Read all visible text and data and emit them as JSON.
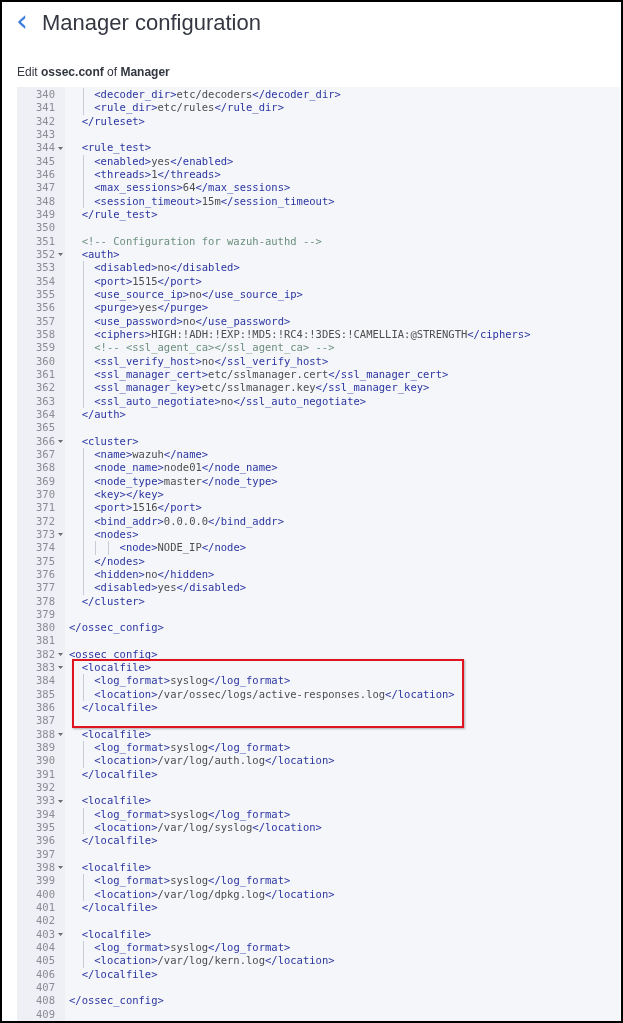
{
  "header": {
    "back": "‹",
    "title": "Manager configuration",
    "subtitle": "Edit **ossec.conf** of **Manager**"
  },
  "editor": {
    "lines": [
      {
        "number": "340",
        "text": "    <decoder_dir>etc/decoders</decoder_dir>",
        "foldable": false,
        "highlighted": false
      },
      {
        "number": "341",
        "text": "    <rule_dir>etc/rules</rule_dir>",
        "foldable": false,
        "highlighted": false
      },
      {
        "number": "342",
        "text": "  </ruleset>",
        "foldable": false,
        "highlighted": false
      },
      {
        "number": "343",
        "foldable": false,
        "highlighted": false
      },
      {
        "number": "344",
        "text": "  <rule_test>",
        "foldable": true,
        "highlighted": false
      },
      {
        "number": "345",
        "text": "    <enabled>yes</enabled>",
        "foldable": false,
        "highlighted": false
      },
      {
        "number": "346",
        "text": "    <threads>1</threads>",
        "foldable": false,
        "highlighted": false
      },
      {
        "number": "347",
        "text": "    <max_sessions>64</max_sessions>",
        "foldable": false,
        "highlighted": false
      },
      {
        "number": "348",
        "text": "    <session_timeout>15m</session_timeout>",
        "foldable": false,
        "highlighted": false
      },
      {
        "number": "349",
        "text": "  </rule_test>",
        "foldable": false,
        "highlighted": false
      },
      {
        "number": "350",
        "foldable": false,
        "highlighted": false
      },
      {
        "number": "351",
        "text": "  <!-- Configuration for wazuh-authd -->",
        "foldable": false,
        "highlighted": false
      },
      {
        "number": "352",
        "text": "  <auth>",
        "foldable": true,
        "highlighted": false
      },
      {
        "number": "353",
        "text": "    <disabled>no</disabled>",
        "foldable": false,
        "highlighted": false
      },
      {
        "number": "354",
        "text": "    <port>1515</port>",
        "foldable": false,
        "highlighted": false
      },
      {
        "number": "355",
        "text": "    <use_source_ip>no</use_source_ip>",
        "foldable": false,
        "highlighted": false
      },
      {
        "number": "356",
        "text": "    <purge>yes</purge>",
        "foldable": false,
        "highlighted": false
      },
      {
        "number": "357",
        "text": "    <use_password>no</use_password>",
        "foldable": false,
        "highlighted": false
      },
      {
        "number": "358",
        "text": "    <ciphers>HIGH:!ADH:!EXP:!MD5:!RC4:!3DES:!CAMELLIA:@STRENGTH</ciphers>",
        "foldable": false,
        "highlighted": false
      },
      {
        "number": "359",
        "text": "    <!-- <ssl_agent_ca></ssl_agent_ca> -->",
        "foldable": false,
        "highlighted": false
      },
      {
        "number": "360",
        "text": "    <ssl_verify_host>no</ssl_verify_host>",
        "foldable": false,
        "highlighted": false
      },
      {
        "number": "361",
        "text": "    <ssl_manager_cert>etc/sslmanager.cert</ssl_manager_cert>",
        "foldable": false,
        "highlighted": false
      },
      {
        "number": "362",
        "text": "    <ssl_manager_key>etc/sslmanager.key</ssl_manager_key>",
        "foldable": false,
        "highlighted": false
      },
      {
        "number": "363",
        "text": "    <ssl_auto_negotiate>no</ssl_auto_negotiate>",
        "foldable": false,
        "highlighted": false
      },
      {
        "number": "364",
        "text": "  </auth>",
        "foldable": false,
        "highlighted": false
      },
      {
        "number": "365",
        "foldable": false,
        "highlighted": false
      },
      {
        "number": "366",
        "text": "  <cluster>",
        "foldable": true,
        "highlighted": false
      },
      {
        "number": "367",
        "text": "    <name>wazuh</name>",
        "foldable": false,
        "highlighted": false
      },
      {
        "number": "368",
        "text": "    <node_name>node01</node_name>",
        "foldable": false,
        "highlighted": false
      },
      {
        "number": "369",
        "text": "    <node_type>master</node_type>",
        "foldable": false,
        "highlighted": false
      },
      {
        "number": "370",
        "text": "    <key></key>",
        "foldable": false,
        "highlighted": false
      },
      {
        "number": "371",
        "text": "    <port>1516</port>",
        "foldable": false,
        "highlighted": false
      },
      {
        "number": "372",
        "text": "    <bind_addr>0.0.0.0</bind_addr>",
        "foldable": false,
        "highlighted": false
      },
      {
        "number": "373",
        "text": "    <nodes>",
        "foldable": true,
        "highlighted": false
      },
      {
        "number": "374",
        "text": "        <node>NODE_IP</node>",
        "foldable": false,
        "highlighted": false
      },
      {
        "number": "375",
        "text": "    </nodes>",
        "foldable": false,
        "highlighted": false
      },
      {
        "number": "376",
        "text": "    <hidden>no</hidden>",
        "foldable": false,
        "highlighted": false
      },
      {
        "number": "377",
        "text": "    <disabled>yes</disabled>",
        "foldable": false,
        "highlighted": false
      },
      {
        "number": "378",
        "text": "  </cluster>",
        "foldable": false,
        "highlighted": false
      },
      {
        "number": "379",
        "foldable": false,
        "highlighted": false
      },
      {
        "number": "380",
        "text": "</ossec_config>",
        "foldable": false,
        "highlighted": false
      },
      {
        "number": "381",
        "foldable": false,
        "highlighted": false
      },
      {
        "number": "382",
        "text": "<ossec_config>",
        "foldable": true,
        "highlighted": false
      },
      {
        "number": "383",
        "text": "  <localfile>",
        "foldable": true,
        "highlighted": true
      },
      {
        "number": "384",
        "text": "    <log_format>syslog</log_format>",
        "foldable": false,
        "highlighted": true
      },
      {
        "number": "385",
        "text": "    <location>/var/ossec/logs/active-responses.log</location>",
        "foldable": false,
        "highlighted": true
      },
      {
        "number": "386",
        "text": "  </localfile>",
        "foldable": false,
        "highlighted": true
      },
      {
        "number": "387",
        "foldable": false,
        "highlighted": true
      },
      {
        "number": "388",
        "text": "  <localfile>",
        "foldable": true,
        "highlighted": false
      },
      {
        "number": "389",
        "text": "    <log_format>syslog</log_format>",
        "foldable": false,
        "highlighted": false
      },
      {
        "number": "390",
        "text": "    <location>/var/log/auth.log</location>",
        "foldable": false,
        "highlighted": false
      },
      {
        "number": "391",
        "text": "  </localfile>",
        "foldable": false,
        "highlighted": false
      },
      {
        "number": "392",
        "foldable": false,
        "highlighted": false
      },
      {
        "number": "393",
        "text": "  <localfile>",
        "foldable": true,
        "highlighted": false
      },
      {
        "number": "394",
        "text": "    <log_format>syslog</log_format>",
        "foldable": false,
        "highlighted": false
      },
      {
        "number": "395",
        "text": "    <location>/var/log/syslog</location>",
        "foldable": false,
        "highlighted": false
      },
      {
        "number": "396",
        "text": "  </localfile>",
        "foldable": false,
        "highlighted": false
      },
      {
        "number": "397",
        "foldable": false,
        "highlighted": false
      },
      {
        "number": "398",
        "text": "  <localfile>",
        "foldable": true,
        "highlighted": false
      },
      {
        "number": "399",
        "text": "    <log_format>syslog</log_format>",
        "foldable": false,
        "highlighted": false
      },
      {
        "number": "400",
        "text": "    <location>/var/log/dpkg.log</location>",
        "foldable": false,
        "highlighted": false
      },
      {
        "number": "401",
        "text": "  </localfile>",
        "foldable": false,
        "highlighted": false
      },
      {
        "number": "402",
        "foldable": false,
        "highlighted": false
      },
      {
        "number": "403",
        "text": "  <localfile>",
        "foldable": true,
        "highlighted": false
      },
      {
        "number": "404",
        "text": "    <log_format>syslog</log_format>",
        "foldable": false,
        "highlighted": false
      },
      {
        "number": "405",
        "text": "    <location>/var/log/kern.log</location>",
        "foldable": false,
        "highlighted": false
      },
      {
        "number": "406",
        "text": "  </localfile>",
        "foldable": false,
        "highlighted": false
      },
      {
        "number": "407",
        "foldable": false,
        "highlighted": false
      },
      {
        "number": "408",
        "text": "</ossec_config>",
        "foldable": false,
        "highlighted": false
      },
      {
        "number": "409",
        "foldable": false,
        "highlighted": false
      }
    ]
  }
}
